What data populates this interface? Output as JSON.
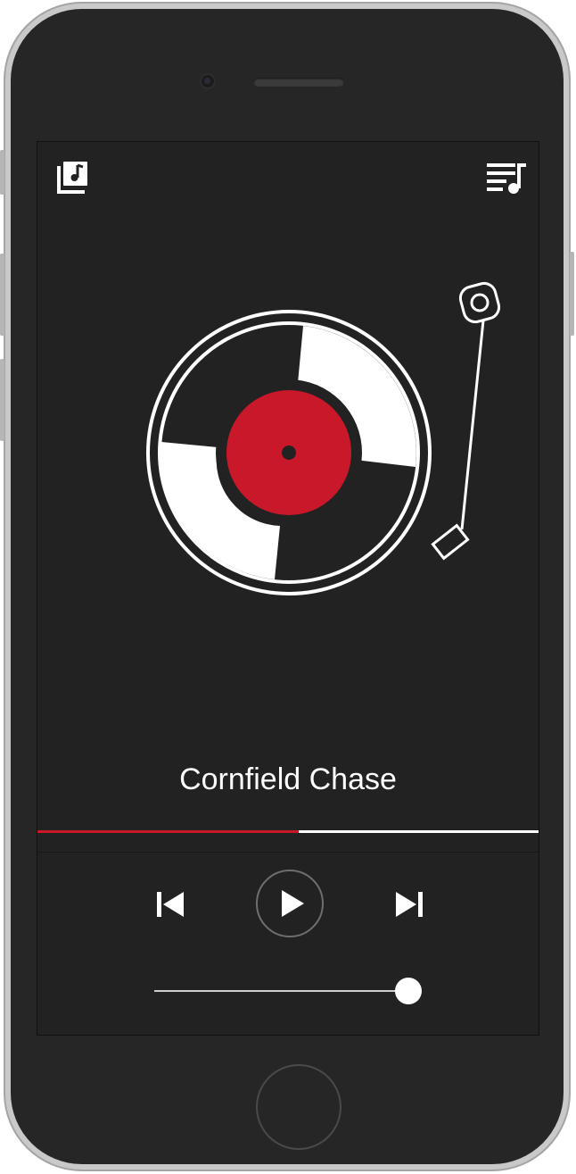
{
  "colors": {
    "screen_bg": "#222222",
    "accent": "#c8182a",
    "foreground": "#ffffff"
  },
  "header": {
    "left_icon": "music-library-icon",
    "right_icon": "playlist-icon"
  },
  "player": {
    "song_title": "Cornfield Chase",
    "progress_fraction": 0.522,
    "volume_fraction": 1.0
  },
  "controls": {
    "prev_icon": "skip-previous-icon",
    "play_icon": "play-icon",
    "next_icon": "skip-next-icon"
  }
}
